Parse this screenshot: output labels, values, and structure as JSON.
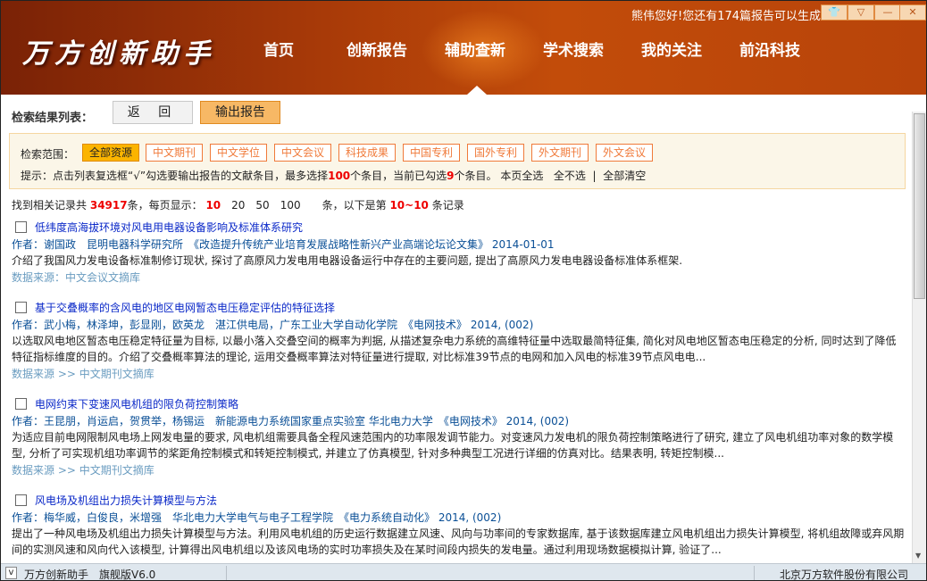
{
  "app": {
    "logo": "万方创新助手",
    "greeting": "熊伟您好!您还有174篇报告可以生成!"
  },
  "window_buttons": [
    {
      "name": "skin-button",
      "glyph": "👕"
    },
    {
      "name": "dropdown-button",
      "glyph": "▽"
    },
    {
      "name": "minimize-button",
      "glyph": "—"
    },
    {
      "name": "close-button",
      "glyph": "✕"
    }
  ],
  "nav": [
    {
      "label": "首页"
    },
    {
      "label": "创新报告"
    },
    {
      "label": "辅助查新",
      "active": true
    },
    {
      "label": "学术搜索"
    },
    {
      "label": "我的关注"
    },
    {
      "label": "前沿科技"
    }
  ],
  "toolbar": {
    "label": "检索结果列表：",
    "back": "返 回",
    "export": "输出报告"
  },
  "filter": {
    "label": "检索范围：",
    "chips": [
      "全部资源",
      "中文期刊",
      "中文学位",
      "中文会议",
      "科技成果",
      "中国专利",
      "国外专利",
      "外文期刊",
      "外文会议"
    ],
    "selected": "全部资源",
    "hint_pre": "提示：点击列表复选框“√”勾选要输出报告的文献条目，最多选择",
    "max": "100",
    "hint_mid": "个条目，当前已勾选",
    "checked": "9",
    "hint_post": "个条目。",
    "select_page": "本页全选",
    "select_none": "全不选",
    "divider": "|",
    "clear_all": "全部清空"
  },
  "results": {
    "pre": "找到相关记录共",
    "total": "34917",
    "unit1": "条，每页显示：",
    "page_sizes": [
      "10",
      "20",
      "50",
      "100"
    ],
    "current_size": "10",
    "unit2": "条，以下是第",
    "range": "10~10",
    "unit3": "条记录"
  },
  "items": [
    {
      "title": "低纬度高海拔环境对风电用电器设备影响及标准体系研究",
      "author": "作者：谢国政　昆明电器科学研究所　《改造提升传统产业培育发展战略性新兴产业高端论坛论文集》 2014-01-01",
      "abstract": "介绍了我国风力发电设备标准制修订现状, 探讨了高原风力发电用电器设备运行中存在的主要问题, 提出了高原风力发电电器设备标准体系框架.",
      "source": "数据来源：中文会议文摘库"
    },
    {
      "title": "基于交叠概率的含风电的地区电网暂态电压稳定评估的特征选择",
      "author": "作者：武小梅，林泽坤，彭显刚，欧英龙　湛江供电局，广东工业大学自动化学院　《电网技术》 2014, (002)",
      "abstract": "以选取风电地区暂态电压稳定特征量为目标, 以最小落入交叠空间的概率为判据, 从描述复杂电力系统的高维特征量中选取最简特征集, 简化对风电地区暂态电压稳定的分析, 同时达到了降低特征指标维度的目的。介绍了交叠概率算法的理论, 运用交叠概率算法对特征量进行提取, 对比标准39节点的电网和加入风电的标准39节点风电电...",
      "source": "数据来源 >> 中文期刊文摘库"
    },
    {
      "title": "电网约束下变速风电机组的限负荷控制策略",
      "author": "作者：王昆朋，肖运启，贺贯举，杨锡运　新能源电力系统国家重点实验室 华北电力大学　《电网技术》 2014, (002)",
      "abstract": "为适应目前电网限制风电场上网发电量的要求, 风电机组需要具备全程风速范围内的功率限发调节能力。对变速风力发电机的限负荷控制策略进行了研究, 建立了风电机组功率对象的数学模型, 分析了可实现机组功率调节的桨距角控制模式和转矩控制模式, 并建立了仿真模型, 针对多种典型工况进行详细的仿真对比。结果表明, 转矩控制模...",
      "source": "数据来源 >> 中文期刊文摘库"
    },
    {
      "title": "风电场及机组出力损失计算模型与方法",
      "author": "作者：梅华威，白俊良，米增强　华北电力大学电气与电子工程学院　《电力系统自动化》 2014, (002)",
      "abstract": "提出了一种风电场及机组出力损失计算模型与方法。利用风电机组的历史运行数据建立风速、风向与功率间的专家数据库, 基于该数据库建立风电机组出力损失计算模型, 将机组故障或弃风期间的实测风速和风向代入该模型, 计算得出风电机组以及该风电场的实时功率损失及在某时间段内损失的发电量。通过利用现场数据模拟计算, 验证了...",
      "source": ""
    }
  ],
  "status": {
    "toggle": "v",
    "app": "万方创新助手　旗舰版V6.0",
    "company": "北京万方软件股份有限公司"
  }
}
